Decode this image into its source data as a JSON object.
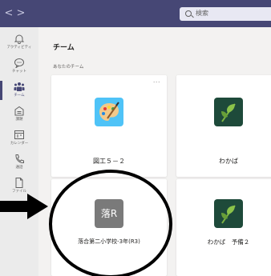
{
  "topbar": {
    "back_glyph": "<",
    "forward_glyph": ">",
    "search_placeholder": "検索",
    "background_color": "#464775"
  },
  "rail": {
    "items": [
      {
        "label": "アクティビティ",
        "icon": "bell-icon"
      },
      {
        "label": "チャット",
        "icon": "chat-icon"
      },
      {
        "label": "チーム",
        "icon": "teams-icon",
        "active": true
      },
      {
        "label": "課題",
        "icon": "assignments-icon"
      },
      {
        "label": "カレンダー",
        "icon": "calendar-icon"
      },
      {
        "label": "通話",
        "icon": "phone-icon"
      },
      {
        "label": "ファイル",
        "icon": "file-icon"
      }
    ]
  },
  "main": {
    "title": "チーム",
    "section_label": "あなたのチーム",
    "more_glyph": "...",
    "teams": [
      {
        "name": "図工５－２",
        "icon": "art-palette-icon"
      },
      {
        "name": "わかば",
        "icon": "leaf-icon"
      },
      {
        "name": "落合第二小学校-3年(R3)",
        "icon_text": "落R",
        "icon_color": "#7a7a7a"
      },
      {
        "name": "わかば　予備２",
        "icon": "leaf-icon"
      }
    ]
  },
  "colors": {
    "accent": "#464775",
    "leaf_tile": "#1e4a3a",
    "art_tile": "#4fc3f7",
    "annotation": "#000000"
  }
}
